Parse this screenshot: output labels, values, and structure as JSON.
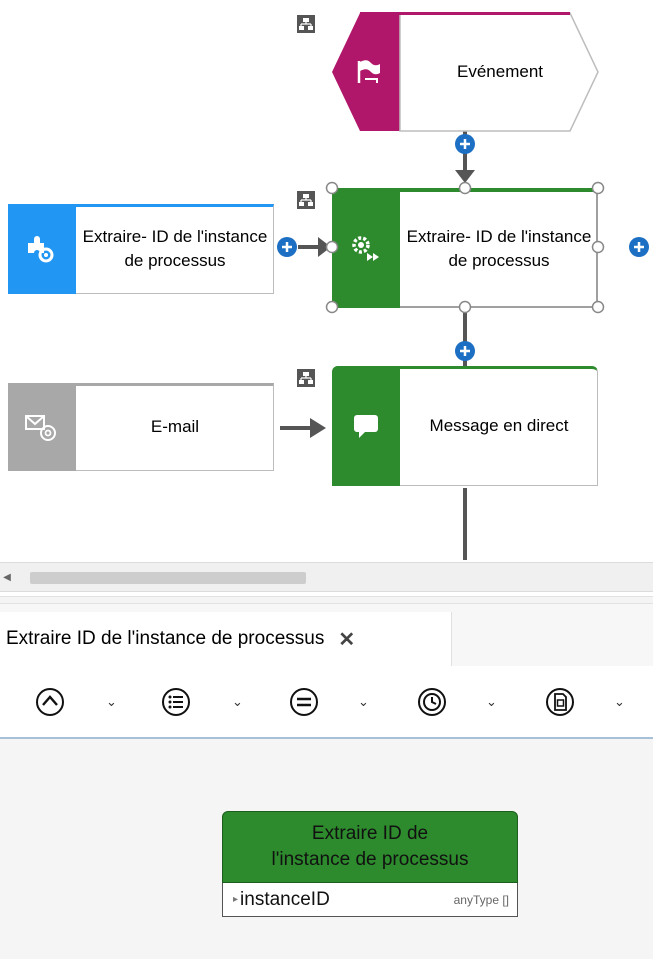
{
  "diagram": {
    "event_label": "Evénement",
    "task1_label": "Extraire- ID de l'instance de processus",
    "service_label": "Extraire- ID de l'instance de processus",
    "task2_label": "Message en direct",
    "email_label": "E-mail"
  },
  "colors": {
    "event": "#b0176a",
    "task": "#2d8a2d",
    "service": "#2196f3",
    "email": "#a8a8a8",
    "connector": "#1d6fc4"
  },
  "editor": {
    "tab_title": "Extraire ID de l'instance de processus",
    "tab_close": "✕",
    "toolbar": [
      {
        "icon": "chevron-up-circle-icon",
        "dropdown": "⌄"
      },
      {
        "icon": "list-circle-icon",
        "dropdown": "⌄"
      },
      {
        "icon": "equals-circle-icon",
        "dropdown": "⌄"
      },
      {
        "icon": "clock-circle-icon",
        "dropdown": "⌄"
      },
      {
        "icon": "document-circle-icon",
        "dropdown": "⌄"
      }
    ]
  },
  "signature": {
    "title": "Extraire ID de\nl'instance de processus",
    "param_arrow": "▸",
    "param_name": "instanceID",
    "param_type": "anyType []"
  }
}
